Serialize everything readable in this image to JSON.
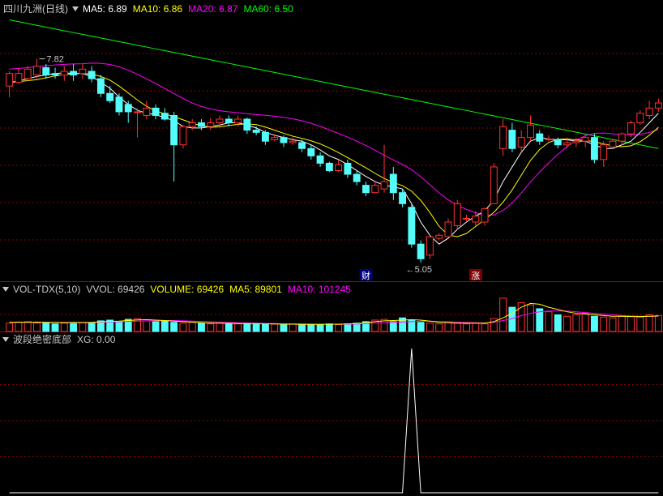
{
  "colors": {
    "up": "#ff3232",
    "down": "#54fcfc",
    "ma5": "#ffffff",
    "ma10": "#ffff00",
    "ma20": "#ff00ff",
    "ma60": "#00ff00",
    "grid": "#8b0000",
    "separator": "#b00000",
    "text": "#c8c8c8"
  },
  "header_main": {
    "title": "四川九洲(日线)",
    "ma5_label": "MA5: 6.89",
    "ma10_label": "MA10: 6.86",
    "ma20_label": "MA20: 6.87",
    "ma60_label": "MA60: 6.50"
  },
  "header_vol": {
    "title": "VOL-TDX(5,10)",
    "vvol_label": "VVOL: 69426",
    "volume_label": "VOLUME: 69426",
    "ma5_label": "MA5: 89801",
    "ma10_label": "MA10: 101245"
  },
  "header_ind": {
    "title": "波段绝密底部",
    "xg_label": "XG: 0.00"
  },
  "annotations": {
    "high_label": "7.82",
    "low_label": "5.05",
    "marker_cai": "财",
    "marker_zhang": "涨"
  },
  "chart_data": [
    {
      "type": "candlestick",
      "title": "四川九洲(日线)",
      "ylim": [
        4.85,
        8.4
      ],
      "high_marker": {
        "value": 7.82,
        "index": 3
      },
      "low_marker": {
        "value": 5.05,
        "index": 43
      },
      "event_markers": [
        {
          "index": 39,
          "label": "财"
        },
        {
          "index": 51,
          "label": "涨"
        }
      ],
      "ohlc": [
        [
          7.45,
          7.62,
          7.3,
          7.65
        ],
        [
          7.5,
          7.62,
          7.48,
          7.7
        ],
        [
          7.55,
          7.68,
          7.52,
          7.72
        ],
        [
          7.6,
          7.72,
          7.55,
          7.82
        ],
        [
          7.7,
          7.6,
          7.55,
          7.75
        ],
        [
          7.62,
          7.6,
          7.55,
          7.7
        ],
        [
          7.6,
          7.65,
          7.52,
          7.72
        ],
        [
          7.65,
          7.6,
          7.52,
          7.75
        ],
        [
          7.62,
          7.68,
          7.55,
          7.75
        ],
        [
          7.65,
          7.55,
          7.5,
          7.72
        ],
        [
          7.55,
          7.35,
          7.3,
          7.6
        ],
        [
          7.35,
          7.25,
          7.22,
          7.45
        ],
        [
          7.3,
          7.1,
          7.05,
          7.35
        ],
        [
          7.2,
          7.1,
          6.95,
          7.25
        ],
        [
          7.1,
          7.1,
          6.75,
          7.15
        ],
        [
          7.05,
          7.15,
          7.0,
          7.25
        ],
        [
          7.15,
          7.05,
          7.0,
          7.2
        ],
        [
          7.08,
          7.0,
          6.98,
          7.15
        ],
        [
          7.05,
          6.65,
          6.15,
          7.1
        ],
        [
          6.65,
          6.9,
          6.6,
          6.92
        ],
        [
          6.9,
          6.95,
          6.85,
          7.0
        ],
        [
          6.95,
          6.9,
          6.85,
          7.0
        ],
        [
          6.9,
          6.95,
          6.85,
          7.02
        ],
        [
          6.95,
          7.0,
          6.9,
          7.05
        ],
        [
          7.0,
          6.95,
          6.9,
          7.05
        ],
        [
          6.95,
          7.0,
          6.9,
          7.05
        ],
        [
          7.0,
          6.85,
          6.8,
          7.02
        ],
        [
          6.85,
          6.82,
          6.78,
          6.9
        ],
        [
          6.82,
          6.7,
          6.65,
          6.85
        ],
        [
          6.72,
          6.75,
          6.7,
          6.8
        ],
        [
          6.75,
          6.68,
          6.62,
          6.78
        ],
        [
          6.68,
          6.7,
          6.65,
          6.75
        ],
        [
          6.68,
          6.6,
          6.55,
          6.72
        ],
        [
          6.6,
          6.5,
          6.45,
          6.65
        ],
        [
          6.5,
          6.4,
          6.35,
          6.55
        ],
        [
          6.4,
          6.3,
          6.28,
          6.42
        ],
        [
          6.3,
          6.38,
          6.28,
          6.45
        ],
        [
          6.4,
          6.25,
          6.2,
          6.45
        ],
        [
          6.25,
          6.15,
          6.1,
          6.3
        ],
        [
          6.1,
          6.0,
          5.95,
          6.15
        ],
        [
          6.0,
          6.1,
          6.0,
          6.15
        ],
        [
          6.05,
          6.15,
          6.0,
          6.65
        ],
        [
          6.25,
          6.0,
          5.9,
          6.35
        ],
        [
          6.0,
          5.85,
          5.8,
          6.05
        ],
        [
          5.8,
          5.3,
          5.25,
          5.85
        ],
        [
          5.3,
          5.1,
          5.05,
          5.35
        ],
        [
          5.15,
          5.4,
          5.1,
          5.42
        ],
        [
          5.38,
          5.42,
          5.35,
          5.45
        ],
        [
          5.4,
          5.6,
          5.4,
          5.65
        ],
        [
          5.55,
          5.85,
          5.5,
          5.9
        ],
        [
          5.65,
          5.65,
          5.6,
          5.7
        ],
        [
          5.6,
          5.68,
          5.55,
          5.75
        ],
        [
          5.6,
          5.78,
          5.55,
          5.8
        ],
        [
          5.85,
          6.35,
          5.85,
          6.4
        ],
        [
          6.6,
          6.9,
          6.5,
          7.0
        ],
        [
          6.85,
          6.6,
          6.55,
          6.95
        ],
        [
          6.62,
          6.75,
          6.55,
          6.85
        ],
        [
          6.75,
          6.92,
          6.7,
          7.05
        ],
        [
          6.8,
          6.7,
          6.65,
          6.85
        ],
        [
          6.72,
          6.73,
          6.7,
          6.78
        ],
        [
          6.72,
          6.65,
          6.6,
          6.75
        ],
        [
          6.65,
          6.68,
          6.6,
          6.75
        ],
        [
          6.68,
          6.7,
          6.62,
          6.75
        ],
        [
          6.7,
          6.75,
          6.62,
          6.8
        ],
        [
          6.75,
          6.45,
          6.4,
          6.8
        ],
        [
          6.45,
          6.65,
          6.35,
          6.7
        ],
        [
          6.62,
          6.7,
          6.6,
          6.72
        ],
        [
          6.7,
          6.8,
          6.65,
          6.82
        ],
        [
          6.8,
          6.95,
          6.75,
          6.98
        ],
        [
          6.95,
          7.08,
          6.92,
          7.12
        ],
        [
          7.05,
          7.15,
          7.0,
          7.25
        ],
        [
          7.15,
          7.22,
          7.1,
          7.28
        ]
      ],
      "ma5": [
        7.5,
        7.52,
        7.55,
        7.58,
        7.6,
        7.62,
        7.63,
        7.62,
        7.62,
        7.58,
        7.5,
        7.42,
        7.3,
        7.2,
        7.12,
        7.08,
        7.06,
        7.02,
        6.98,
        6.9,
        6.88,
        6.88,
        6.9,
        6.92,
        6.95,
        6.95,
        6.92,
        6.88,
        6.82,
        6.78,
        6.75,
        6.72,
        6.7,
        6.65,
        6.58,
        6.5,
        6.45,
        6.38,
        6.3,
        6.22,
        6.15,
        6.1,
        6.08,
        6.05,
        5.85,
        5.6,
        5.42,
        5.3,
        5.38,
        5.5,
        5.6,
        5.68,
        5.75,
        5.9,
        6.15,
        6.35,
        6.55,
        6.7,
        6.75,
        6.73,
        6.72,
        6.72,
        6.7,
        6.7,
        6.65,
        6.6,
        6.6,
        6.65,
        6.7,
        6.82,
        6.95,
        7.08
      ]
    },
    {
      "type": "bar",
      "title": "VOL-TDX(5,10)",
      "values": [
        0.55,
        0.6,
        0.65,
        0.55,
        0.6,
        0.5,
        0.55,
        0.52,
        0.6,
        0.55,
        0.7,
        0.75,
        0.65,
        0.8,
        0.85,
        0.7,
        0.65,
        0.7,
        0.6,
        0.55,
        0.6,
        0.55,
        0.5,
        0.55,
        0.52,
        0.5,
        0.55,
        0.52,
        0.5,
        0.48,
        0.45,
        0.5,
        0.45,
        0.48,
        0.45,
        0.5,
        0.45,
        0.5,
        0.55,
        0.65,
        0.75,
        0.8,
        0.65,
        0.9,
        0.75,
        0.6,
        0.55,
        0.5,
        0.6,
        0.55,
        0.5,
        0.55,
        0.5,
        0.85,
        2.2,
        1.6,
        1.9,
        1.75,
        1.5,
        1.3,
        1.1,
        1.0,
        1.1,
        1.2,
        1.0,
        0.95,
        0.9,
        1.0,
        1.0,
        0.95,
        1.1,
        1.05
      ],
      "ma5": [
        0.6,
        0.62,
        0.6,
        0.62,
        0.6,
        0.6,
        0.58,
        0.6,
        0.58,
        0.6,
        0.64,
        0.66,
        0.68,
        0.72,
        0.76,
        0.78,
        0.75,
        0.72,
        0.68,
        0.65,
        0.62,
        0.58,
        0.56,
        0.55,
        0.54,
        0.52,
        0.52,
        0.52,
        0.5,
        0.5,
        0.48,
        0.48,
        0.47,
        0.47,
        0.47,
        0.48,
        0.48,
        0.5,
        0.52,
        0.58,
        0.65,
        0.7,
        0.72,
        0.75,
        0.78,
        0.75,
        0.68,
        0.6,
        0.58,
        0.55,
        0.55,
        0.55,
        0.55,
        0.65,
        0.9,
        1.2,
        1.6,
        1.85,
        1.8,
        1.6,
        1.45,
        1.3,
        1.2,
        1.15,
        1.1,
        1.05,
        1.0,
        1.0,
        0.98,
        0.98,
        1.0,
        1.02
      ],
      "ma10": [
        0.6,
        0.6,
        0.6,
        0.6,
        0.6,
        0.6,
        0.6,
        0.6,
        0.6,
        0.6,
        0.61,
        0.63,
        0.64,
        0.66,
        0.68,
        0.7,
        0.71,
        0.72,
        0.72,
        0.7,
        0.68,
        0.66,
        0.64,
        0.62,
        0.6,
        0.58,
        0.56,
        0.55,
        0.53,
        0.52,
        0.51,
        0.5,
        0.5,
        0.49,
        0.48,
        0.48,
        0.48,
        0.48,
        0.49,
        0.52,
        0.55,
        0.58,
        0.6,
        0.62,
        0.65,
        0.68,
        0.68,
        0.66,
        0.65,
        0.62,
        0.6,
        0.58,
        0.56,
        0.6,
        0.72,
        0.85,
        1.05,
        1.2,
        1.3,
        1.35,
        1.35,
        1.35,
        1.3,
        1.25,
        1.2,
        1.15,
        1.1,
        1.05,
        1.02,
        1.0,
        1.0,
        1.0
      ]
    },
    {
      "type": "line",
      "title": "波段绝密底部",
      "ylim": [
        0,
        1
      ],
      "series": [
        {
          "name": "XG",
          "values": [
            0,
            0,
            0,
            0,
            0,
            0,
            0,
            0,
            0,
            0,
            0,
            0,
            0,
            0,
            0,
            0,
            0,
            0,
            0,
            0,
            0,
            0,
            0,
            0,
            0,
            0,
            0,
            0,
            0,
            0,
            0,
            0,
            0,
            0,
            0,
            0,
            0,
            0,
            0,
            0,
            0,
            0,
            0,
            0,
            1,
            0,
            0,
            0,
            0,
            0,
            0,
            0,
            0,
            0,
            0,
            0,
            0,
            0,
            0,
            0,
            0,
            0,
            0,
            0,
            0,
            0,
            0,
            0,
            0,
            0,
            0,
            0
          ]
        }
      ]
    }
  ]
}
